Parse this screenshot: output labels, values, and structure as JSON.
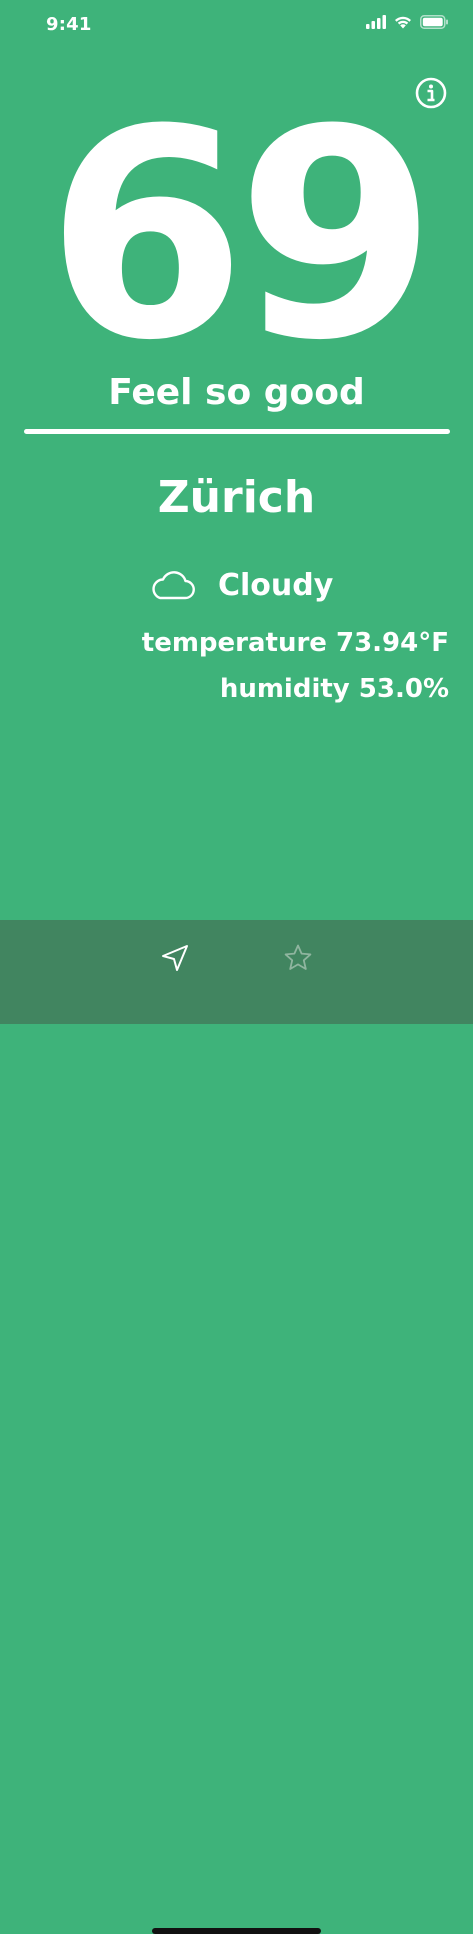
{
  "status_bar": {
    "time": "9:41"
  },
  "reading": {
    "value": "69",
    "mood": "Feel so good"
  },
  "location": {
    "city": "Zürich"
  },
  "weather": {
    "condition": "Cloudy",
    "condition_icon": "cloud-icon",
    "temperature_text": "temperature 73.94°F",
    "humidity_text": "humidity 53.0%"
  },
  "tab_bar": {
    "items": [
      {
        "icon": "location-arrow-icon",
        "selected": true
      },
      {
        "icon": "star-icon",
        "selected": false
      }
    ]
  },
  "colors": {
    "background": "#3EB37A",
    "tab_bar": "#418560",
    "text": "#FFFFFF",
    "inactive_icon": "#8FB59F"
  }
}
